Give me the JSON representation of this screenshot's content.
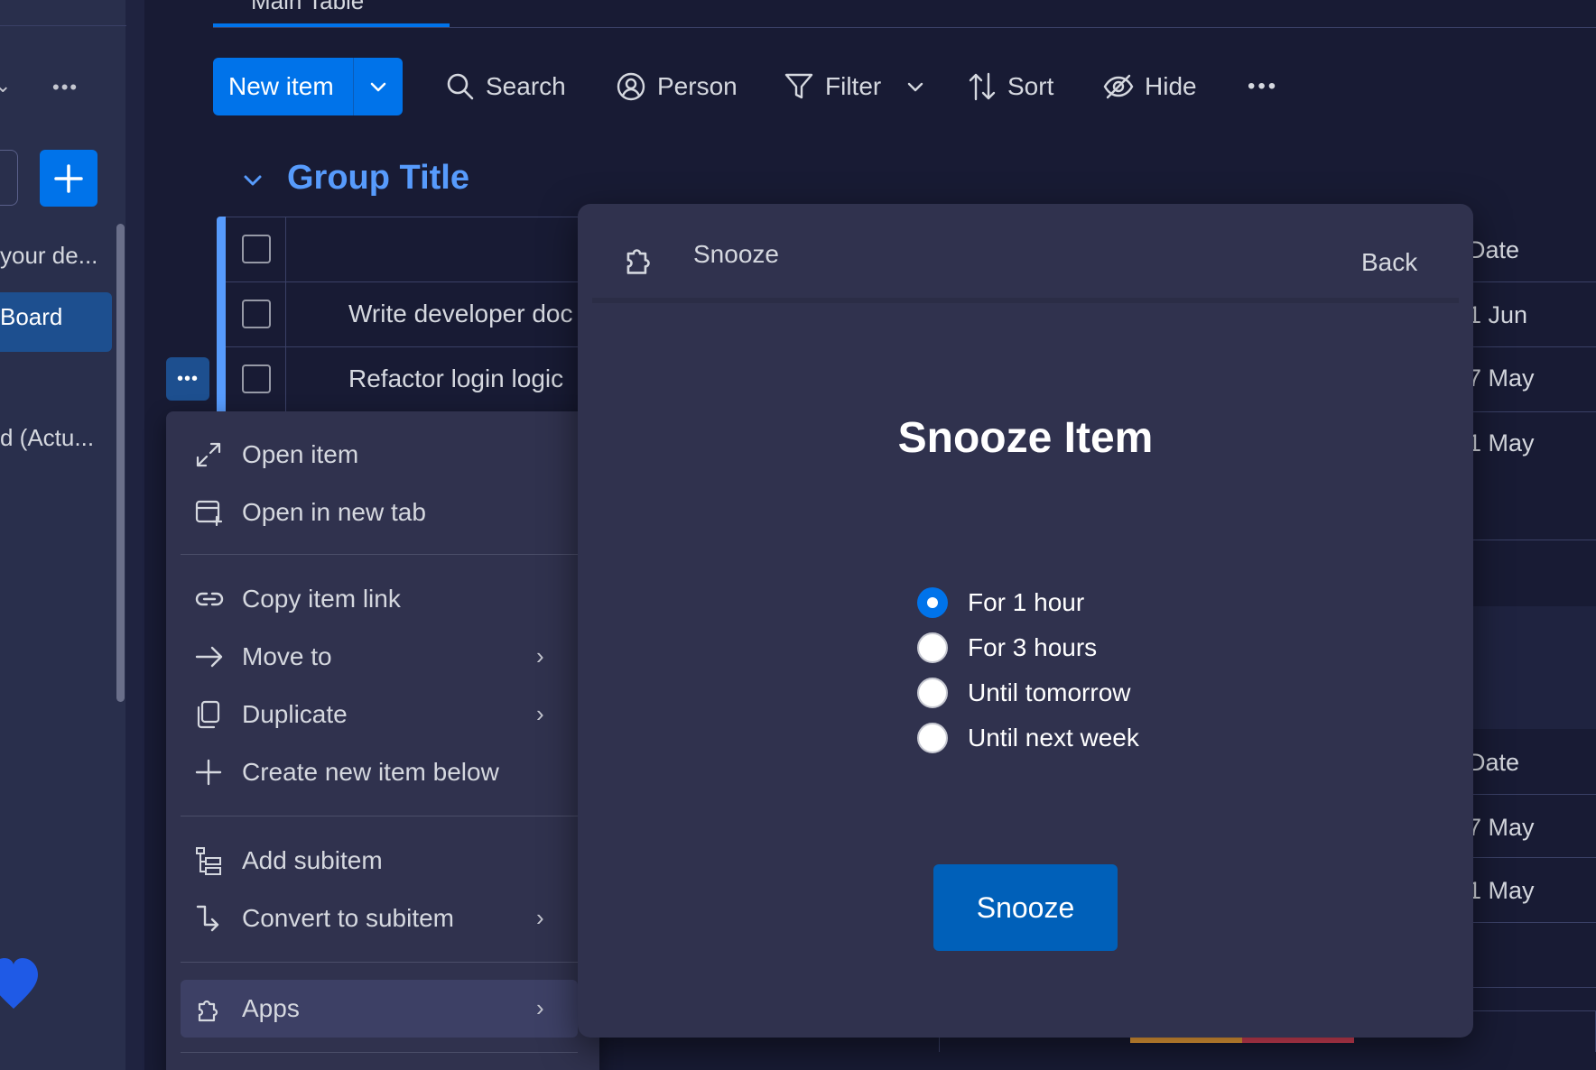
{
  "sidebar": {
    "items": [
      {
        "label": "your de..."
      },
      {
        "label": "Board"
      },
      {
        "label": "d (Actu..."
      }
    ]
  },
  "top_tab": {
    "label": "Main Table"
  },
  "toolbar": {
    "new_item_label": "New item",
    "search_label": "Search",
    "person_label": "Person",
    "filter_label": "Filter",
    "sort_label": "Sort",
    "hide_label": "Hide"
  },
  "group": {
    "title": "Group Title",
    "rows": [
      {
        "name": "Write developer doc"
      },
      {
        "name": "Refactor login logic"
      }
    ],
    "right_column": {
      "header_top": "Date",
      "dates_top": [
        "1 Jun",
        "7 May",
        "1 May"
      ],
      "header_bottom": "Date",
      "dates_bottom": [
        "7 May",
        "1 May"
      ]
    }
  },
  "context_menu": {
    "items": [
      {
        "label": "Open item",
        "icon": "expand-icon"
      },
      {
        "label": "Open in new tab",
        "icon": "new-tab-icon"
      },
      {
        "label": "Copy item link",
        "icon": "link-icon"
      },
      {
        "label": "Move to",
        "icon": "arrow-right-icon"
      },
      {
        "label": "Duplicate",
        "icon": "copy-icon"
      },
      {
        "label": "Create new item below",
        "icon": "plus-icon"
      },
      {
        "label": "Add subitem",
        "icon": "subitem-icon"
      },
      {
        "label": "Convert to subitem",
        "icon": "convert-icon"
      },
      {
        "label": "Apps",
        "icon": "puzzle-icon"
      }
    ]
  },
  "snooze_modal": {
    "header_title": "Snooze",
    "back_label": "Back",
    "heading": "Snooze Item",
    "options": [
      {
        "label": "For 1 hour",
        "selected": true
      },
      {
        "label": "For 3 hours",
        "selected": false
      },
      {
        "label": "Until tomorrow",
        "selected": false
      },
      {
        "label": "Until next week",
        "selected": false
      }
    ],
    "submit_label": "Snooze"
  },
  "colors": {
    "background": "#181b34",
    "surface": "#30324e",
    "accent": "#0073ea",
    "group_title": "#579bfc"
  }
}
